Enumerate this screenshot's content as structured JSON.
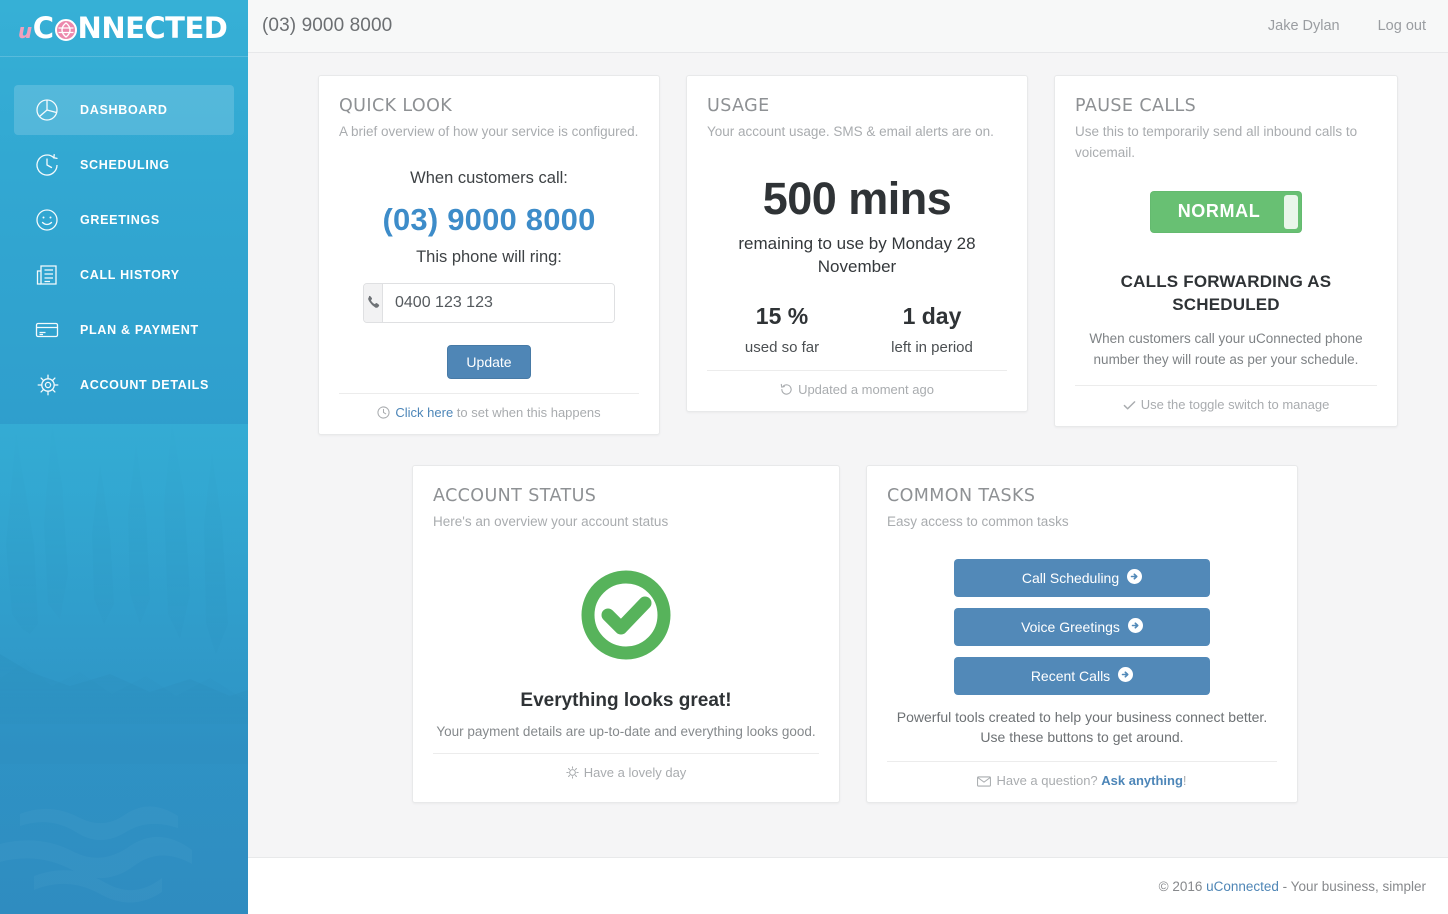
{
  "brand": {
    "logo_u": "u",
    "logo_c": "C",
    "logo_rest": "NNECTE",
    "logo_d": "D",
    "logo_full": "uCONNECTED",
    "accent_blue": "#34acd4",
    "accent_pink": "#ef9ebc",
    "link_blue": "#4d86b8",
    "button_blue": "#5289b8",
    "green": "#68c073"
  },
  "sidebar": {
    "items": [
      {
        "label": "DASHBOARD",
        "icon": "pie-chart-icon",
        "active": true
      },
      {
        "label": "SCHEDULING",
        "icon": "clock-icon",
        "active": false
      },
      {
        "label": "GREETINGS",
        "icon": "smiley-icon",
        "active": false
      },
      {
        "label": "CALL HISTORY",
        "icon": "list-document-icon",
        "active": false
      },
      {
        "label": "PLAN & PAYMENT",
        "icon": "credit-card-icon",
        "active": false
      },
      {
        "label": "ACCOUNT DETAILS",
        "icon": "gear-icon",
        "active": false
      }
    ]
  },
  "topbar": {
    "phone": "(03) 9000 8000",
    "user": "Jake Dylan",
    "logout": "Log out"
  },
  "quick_look": {
    "title": "QUICK LOOK",
    "subtitle": "A brief overview of how your service is configured.",
    "when_label": "When customers call:",
    "number": "(03) 9000 8000",
    "ring_label": "This phone will ring:",
    "phone_value": "0400 123 123",
    "phone_placeholder": "0400 123 123",
    "phone_icon": "phone-icon",
    "update_label": "Update",
    "footer_icon": "clock-icon",
    "footer_link": "Click here",
    "footer_text": " to set when this happens"
  },
  "usage": {
    "title": "USAGE",
    "subtitle": "Your account usage. SMS & email alerts are on.",
    "remaining": "500 mins",
    "remaining_sub": "remaining to use by Monday 28 November",
    "stats": [
      {
        "value": "15 %",
        "label": "used so far"
      },
      {
        "value": "1 day",
        "label": "left in period"
      }
    ],
    "footer_icon": "refresh-icon",
    "footer_text": "Updated a moment ago"
  },
  "pause_calls": {
    "title": "PAUSE CALLS",
    "subtitle": "Use this to temporarily send all inbound calls to voicemail.",
    "toggle_label": "NORMAL",
    "toggle_state": "normal",
    "status_title": "CALLS FORWARDING AS SCHEDULED",
    "status_desc": "When customers call your uConnected phone number they will route as per your schedule.",
    "footer_icon": "check-icon",
    "footer_text": "Use the toggle switch to manage"
  },
  "account_status": {
    "title": "ACCOUNT STATUS",
    "subtitle": "Here's an overview your account status",
    "status_icon": "check-circle-icon",
    "headline": "Everything looks great!",
    "description": "Your payment details are up-to-date and everything looks good.",
    "footer_icon": "sun-icon",
    "footer_text": "Have a lovely day"
  },
  "common_tasks": {
    "title": "COMMON TASKS",
    "subtitle": "Easy access to common tasks",
    "buttons": [
      {
        "label": "Call Scheduling",
        "icon": "arrow-right-circle-icon"
      },
      {
        "label": "Voice Greetings",
        "icon": "arrow-right-circle-icon"
      },
      {
        "label": "Recent Calls",
        "icon": "arrow-right-circle-icon"
      }
    ],
    "description": "Powerful tools created to help your business connect better. Use these buttons to get around.",
    "footer_icon": "envelope-icon",
    "footer_question": "Have a question? ",
    "footer_link": "Ask anything",
    "footer_bang": "!"
  },
  "footer": {
    "copyright": "© 2016 ",
    "link": "uConnected",
    "tagline": " - Your business, simpler"
  }
}
